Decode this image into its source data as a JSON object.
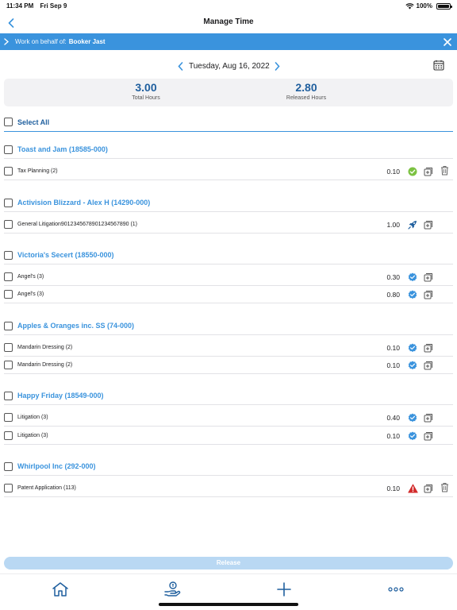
{
  "status_bar": {
    "time": "11:34 PM",
    "date": "Fri Sep 9",
    "battery": "100%"
  },
  "nav": {
    "title": "Manage Time"
  },
  "behalf": {
    "label": "Work on behalf of:",
    "name": "Booker Jast"
  },
  "date_nav": {
    "date": "Tuesday, Aug 16, 2022"
  },
  "totals": {
    "total_hours": "3.00",
    "total_label": "Total Hours",
    "released_hours": "2.80",
    "released_label": "Released Hours"
  },
  "select_all": {
    "label": "Select All"
  },
  "groups": [
    {
      "name": "Toast and Jam (18585-000)",
      "entries": [
        {
          "name": "Tax Planning (2)",
          "hours": "0.10",
          "status": "check-green-icon",
          "has_delete": true
        }
      ]
    },
    {
      "name": "Activision Blizzard - Alex H (14290-000)",
      "entries": [
        {
          "name": "General Litigation9012345678901234567890 (1)",
          "hours": "1.00",
          "status": "rocket-icon",
          "has_delete": false
        }
      ]
    },
    {
      "name": "Victoria's Secert (18550-000)",
      "entries": [
        {
          "name": "Angel's (3)",
          "hours": "0.30",
          "status": "verified-badge-icon",
          "has_delete": false
        },
        {
          "name": "Angel's (3)",
          "hours": "0.80",
          "status": "verified-badge-icon",
          "has_delete": false
        }
      ]
    },
    {
      "name": "Apples & Oranges inc. SS (74-000)",
      "entries": [
        {
          "name": "Mandarin Dressing (2)",
          "hours": "0.10",
          "status": "verified-badge-icon",
          "has_delete": false
        },
        {
          "name": "Mandarin Dressing (2)",
          "hours": "0.10",
          "status": "verified-badge-icon",
          "has_delete": false
        }
      ]
    },
    {
      "name": "Happy Friday (18549-000)",
      "entries": [
        {
          "name": "Litigation (3)",
          "hours": "0.40",
          "status": "verified-badge-icon",
          "has_delete": false
        },
        {
          "name": "Litigation (3)",
          "hours": "0.10",
          "status": "verified-badge-icon",
          "has_delete": false
        }
      ]
    },
    {
      "name": "Whirlpool Inc (292-000)",
      "entries": [
        {
          "name": "Patent Application (113)",
          "hours": "0.10",
          "status": "warning-triangle-icon",
          "has_delete": true
        }
      ]
    }
  ],
  "release": {
    "label": "Release"
  },
  "tabs": [
    "home-icon",
    "hand-coin-icon",
    "plus-icon",
    "more-icon"
  ],
  "colors": {
    "accent": "#3a93dd",
    "heading": "#1f5f9e",
    "release_disabled": "#b9d8f3",
    "check": "#7cc242",
    "warning": "#d22b2b",
    "rocket": "#1f5f9e"
  }
}
